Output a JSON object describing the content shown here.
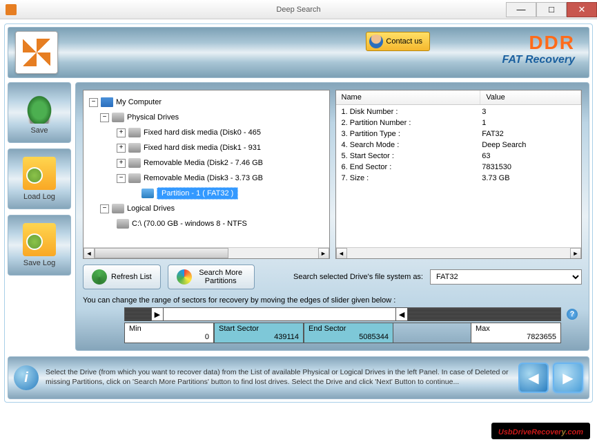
{
  "window": {
    "title": "Deep Search",
    "minimize": "—",
    "maximize": "□",
    "close": "✕"
  },
  "header": {
    "contact_label": "Contact us",
    "brand_main": "DDR",
    "brand_sub": "FAT Recovery"
  },
  "sidebar": {
    "save": "Save",
    "load_log": "Load Log",
    "save_log": "Save Log"
  },
  "tree": {
    "root": "My Computer",
    "physical": "Physical Drives",
    "disk0": "Fixed hard disk media (Disk0 - 465",
    "disk1": "Fixed hard disk media (Disk1 - 931",
    "disk2": "Removable Media (Disk2 - 7.46 GB",
    "disk3": "Removable Media (Disk3 - 3.73 GB",
    "partition": "Partition - 1 ( FAT32 )",
    "logical": "Logical Drives",
    "drive_c": "C:\\ (70.00 GB - windows 8 - NTFS"
  },
  "details": {
    "header_name": "Name",
    "header_value": "Value",
    "rows": [
      {
        "name": "1. Disk Number :",
        "value": "3"
      },
      {
        "name": "2. Partition Number :",
        "value": "1"
      },
      {
        "name": "3. Partition Type :",
        "value": "FAT32"
      },
      {
        "name": "4. Search Mode :",
        "value": "Deep Search"
      },
      {
        "name": "5. Start Sector :",
        "value": "63"
      },
      {
        "name": "6. End Sector :",
        "value": "7831530"
      },
      {
        "name": "7. Size :",
        "value": "3.73 GB"
      }
    ]
  },
  "buttons": {
    "refresh": "Refresh List",
    "search_more": "Search More Partitions"
  },
  "fs": {
    "label": "Search selected Drive's file system as:",
    "value": "FAT32"
  },
  "slider": {
    "instruction": "You can change the range of sectors for recovery by moving the edges of slider given below :",
    "min_label": "Min",
    "min_value": "0",
    "start_label": "Start Sector",
    "start_value": "439114",
    "end_label": "End Sector",
    "end_value": "5085344",
    "max_label": "Max",
    "max_value": "7823655",
    "help": "?"
  },
  "footer": {
    "text": "Select the Drive (from which you want to recover data) from the List of available Physical or Logical Drives in the left Panel. In case of Deleted or missing Partitions, click on 'Search More Partitions' button to find lost drives. Select the Drive and click 'Next' Button to continue...",
    "back": "◀",
    "next": "▶"
  },
  "watermark": {
    "pre": "UsbDriveRecover",
    "y": "y",
    "suf": ".com"
  },
  "scroll": {
    "left": "◄",
    "right": "►"
  }
}
